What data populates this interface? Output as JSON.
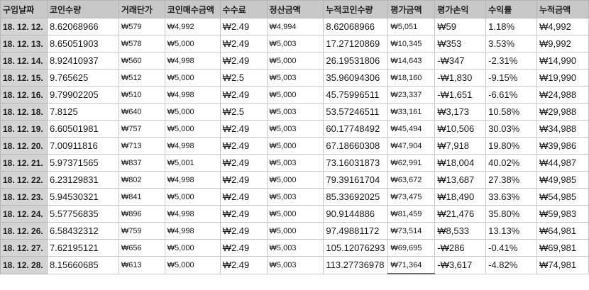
{
  "columns": [
    "구입날짜",
    "코인수량",
    "거래단가",
    "코인매수금액",
    "수수료",
    "정산금액",
    "누적코인수량",
    "평가금액",
    "평가손익",
    "수익률",
    "누적금액"
  ],
  "rows": [
    [
      "18. 12. 12.",
      "8.62068966",
      "₩579",
      "₩4,992",
      "₩2.49",
      "₩4,994",
      "8.62068966",
      "₩5,051",
      "₩59",
      "1.18%",
      "₩4,992"
    ],
    [
      "18. 12. 13.",
      "8.65051903",
      "₩578",
      "₩5,000",
      "₩2.49",
      "₩5,003",
      "17.27120869",
      "₩10,345",
      "₩353",
      "3.53%",
      "₩9,992"
    ],
    [
      "18. 12. 14.",
      "8.92410937",
      "₩560",
      "₩4,998",
      "₩2.49",
      "₩5,000",
      "26.19531806",
      "₩14,643",
      "-₩347",
      "-2.31%",
      "₩14,990"
    ],
    [
      "18. 12. 15.",
      "9.765625",
      "₩512",
      "₩5,000",
      "₩2.5",
      "₩5,003",
      "35.96094306",
      "₩18,160",
      "-₩1,830",
      "-9.15%",
      "₩19,990"
    ],
    [
      "18. 12. 16.",
      "9.79902205",
      "₩510",
      "₩4,998",
      "₩2.49",
      "₩5,000",
      "45.75996511",
      "₩23,337",
      "-₩1,651",
      "-6.61%",
      "₩24,988"
    ],
    [
      "18. 12. 18.",
      "7.8125",
      "₩640",
      "₩5,000",
      "₩2.5",
      "₩5,003",
      "53.57246511",
      "₩33,161",
      "₩3,173",
      "10.58%",
      "₩29,988"
    ],
    [
      "18. 12. 19.",
      "6.60501981",
      "₩757",
      "₩5,000",
      "₩2.49",
      "₩5,003",
      "60.17748492",
      "₩45,494",
      "₩10,506",
      "30.03%",
      "₩34,988"
    ],
    [
      "18. 12. 20.",
      "7.00911816",
      "₩713",
      "₩4,998",
      "₩2.49",
      "₩5,000",
      "67.18660308",
      "₩47,904",
      "₩7,918",
      "19.80%",
      "₩39,986"
    ],
    [
      "18. 12. 21.",
      "5.97371565",
      "₩837",
      "₩5,001",
      "₩2.49",
      "₩5,003",
      "73.16031873",
      "₩62,991",
      "₩18,004",
      "40.02%",
      "₩44,987"
    ],
    [
      "18. 12. 22.",
      "6.23129831",
      "₩802",
      "₩4,998",
      "₩2.49",
      "₩5,000",
      "79.39161704",
      "₩63,672",
      "₩13,687",
      "27.38%",
      "₩49,985"
    ],
    [
      "18. 12. 23.",
      "5.94530321",
      "₩841",
      "₩5,000",
      "₩2.49",
      "₩5,003",
      "85.33692025",
      "₩73,475",
      "₩18,490",
      "33.63%",
      "₩54,985"
    ],
    [
      "18. 12. 24.",
      "5.57756835",
      "₩896",
      "₩4,998",
      "₩2.49",
      "₩5,000",
      "90.9144886",
      "₩81,459",
      "₩21,476",
      "35.80%",
      "₩59,983"
    ],
    [
      "18. 12. 26.",
      "6.58432312",
      "₩759",
      "₩4,998",
      "₩2.49",
      "₩5,000",
      "97.49881172",
      "₩73,514",
      "₩8,533",
      "13.13%",
      "₩64,981"
    ],
    [
      "18. 12. 27.",
      "7.62195121",
      "₩656",
      "₩5,000",
      "₩2.49",
      "₩5,003",
      "105.12076293",
      "₩69,695",
      "-₩286",
      "-0.41%",
      "₩69,981"
    ],
    [
      "18. 12. 28.",
      "8.15660685",
      "₩613",
      "₩5,000",
      "₩2.49",
      "₩5,003",
      "113.27736978",
      "₩71,364",
      "-₩3,617",
      "-4.82%",
      "₩74,981"
    ]
  ]
}
